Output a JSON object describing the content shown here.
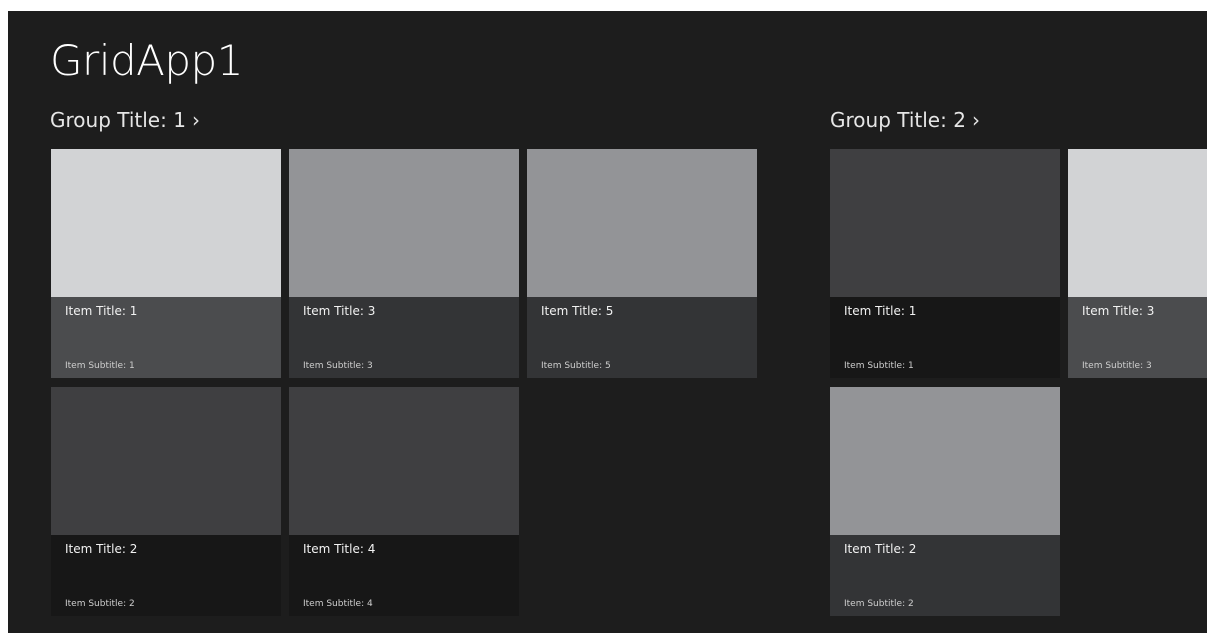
{
  "app": {
    "title": "GridApp1"
  },
  "groups": [
    {
      "title": "Group Title: 1",
      "chevron": "›",
      "items": [
        {
          "title": "Item Title: 1",
          "subtitle": "Item Subtitle: 1",
          "image_color": "#d2d3d5",
          "overlay_color": "#4b4c4e"
        },
        {
          "title": "Item Title: 2",
          "subtitle": "Item Subtitle: 2",
          "image_color": "#3f3f41",
          "overlay_color": "#171717"
        },
        {
          "title": "Item Title: 3",
          "subtitle": "Item Subtitle: 3",
          "image_color": "#939497",
          "overlay_color": "#333436"
        },
        {
          "title": "Item Title: 4",
          "subtitle": "Item Subtitle: 4",
          "image_color": "#3f3f41",
          "overlay_color": "#171717"
        },
        {
          "title": "Item Title: 5",
          "subtitle": "Item Subtitle: 5",
          "image_color": "#939497",
          "overlay_color": "#333436"
        }
      ]
    },
    {
      "title": "Group Title: 2",
      "chevron": "›",
      "items": [
        {
          "title": "Item Title: 1",
          "subtitle": "Item Subtitle: 1",
          "image_color": "#3f3f41",
          "overlay_color": "#171717"
        },
        {
          "title": "Item Title: 2",
          "subtitle": "Item Subtitle: 2",
          "image_color": "#939497",
          "overlay_color": "#333436"
        },
        {
          "title": "Item Title: 3",
          "subtitle": "Item Subtitle: 3",
          "image_color": "#d2d3d5",
          "overlay_color": "#4b4c4e"
        }
      ]
    }
  ]
}
